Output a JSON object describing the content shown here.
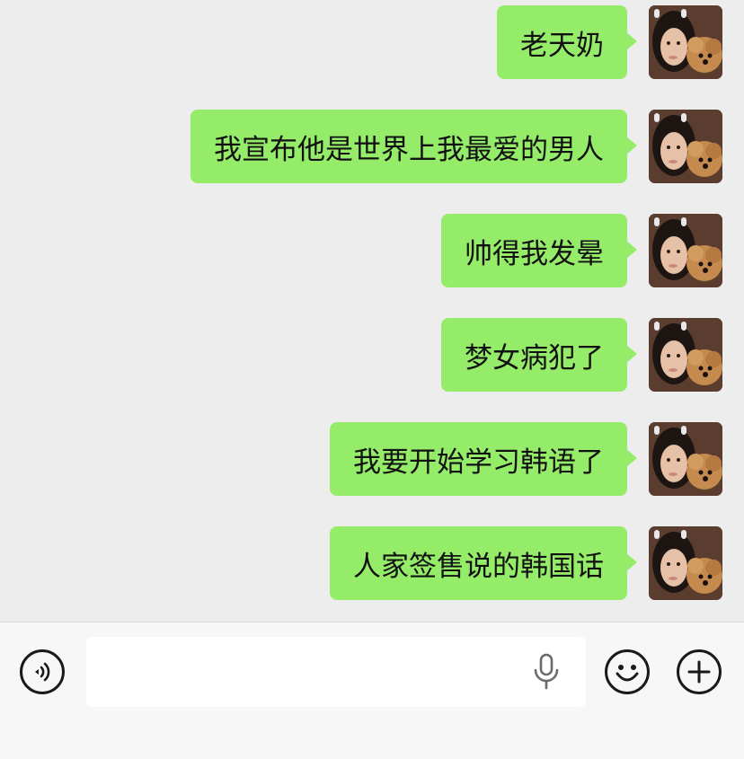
{
  "messages": [
    {
      "text": "老天奶"
    },
    {
      "text": "我宣布他是世界上我最爱的男人"
    },
    {
      "text": "帅得我发晕"
    },
    {
      "text": "梦女病犯了"
    },
    {
      "text": "我要开始学习韩语了"
    },
    {
      "text": "人家签售说的韩国话"
    }
  ],
  "input": {
    "value": "",
    "placeholder": ""
  },
  "icons": {
    "voice": "voice-wave-icon",
    "mic": "microphone-icon",
    "emoji": "smiley-face-icon",
    "plus": "plus-icon"
  },
  "colors": {
    "bubble": "#95ec69",
    "chat_background": "#ededed",
    "input_bar": "#f7f7f7"
  }
}
